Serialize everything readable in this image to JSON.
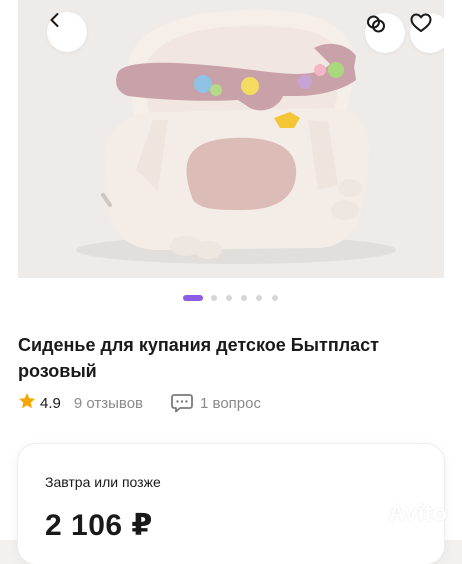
{
  "header": {
    "back_icon": "chevron-left-icon",
    "compare_icon": "compare-icon",
    "favorite_icon": "heart-outline-icon"
  },
  "gallery": {
    "image_description_icon": "bath-seat-photo",
    "dots_total": 6,
    "active_index": 0
  },
  "product": {
    "title": "Сиденье для купания детское Бытпласт розовый",
    "rating": "4.9",
    "reviews": "9 отзывов",
    "questions": "1 вопрос"
  },
  "delivery_card": {
    "delivery_label": "Завтра или позже",
    "price": "2 106 ₽"
  },
  "watermark": {
    "text": "Avito"
  },
  "colors": {
    "accent": "#8c5ce6",
    "star": "#f7a600",
    "muted_text": "#8a8a8a"
  }
}
